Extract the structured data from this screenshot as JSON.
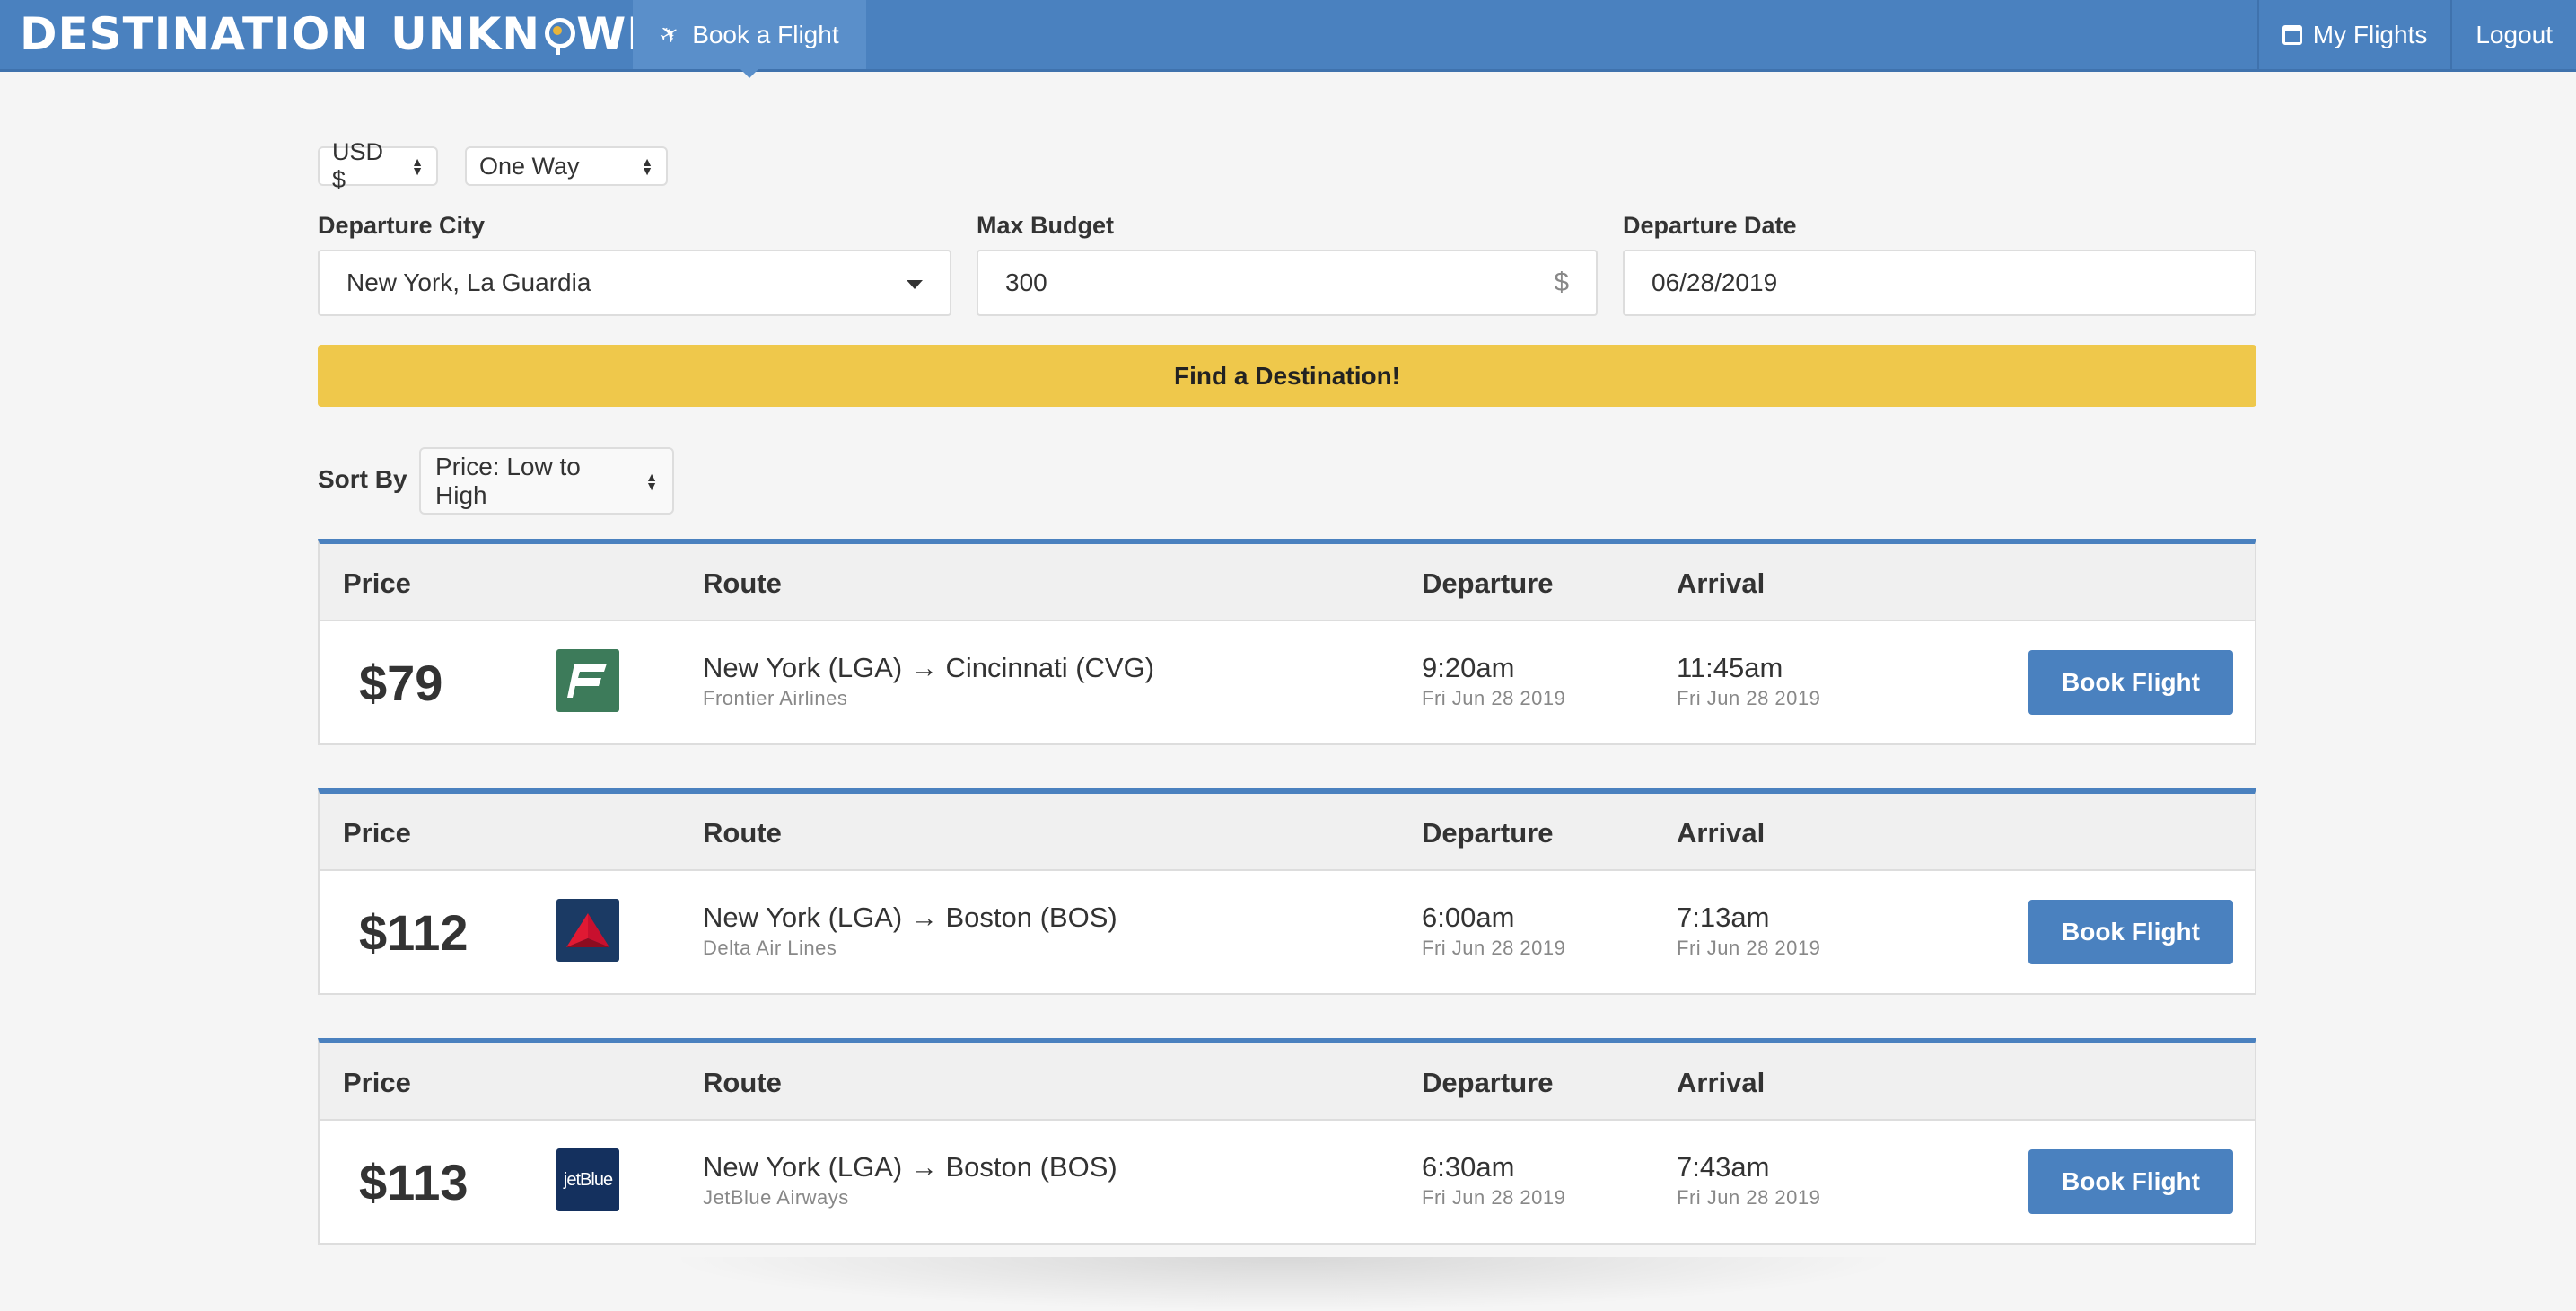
{
  "header": {
    "logo_word1": "DESTINATION",
    "logo_word2_pre": "UNKN",
    "logo_word2_post": "WN",
    "nav_tab": "Book a Flight",
    "nav_right": [
      "My Flights",
      "Logout"
    ],
    "colors": {
      "bar": "#4a81bf",
      "accent_dot": "#e8b43a"
    }
  },
  "form": {
    "currency": "USD $",
    "trip_type": "One Way",
    "departure_city_label": "Departure City",
    "departure_city_value": "New York, La Guardia",
    "max_budget_label": "Max Budget",
    "max_budget_value": "300",
    "budget_unit": "$",
    "departure_date_label": "Departure Date",
    "departure_date_value": "06/28/2019",
    "find_button": "Find a Destination!",
    "find_button_color": "#efc84b",
    "sort_label": "Sort By",
    "sort_value": "Price: Low to High"
  },
  "columns": {
    "price": "Price",
    "route": "Route",
    "departure": "Departure",
    "arrival": "Arrival"
  },
  "results": [
    {
      "price": "$79",
      "logo": "frontier-logo",
      "logo_color": "#3d7b5a",
      "route": "New York (LGA) → Cincinnati (CVG)",
      "airline": "Frontier Airlines",
      "dep_time": "9:20am",
      "dep_date": "Fri Jun 28 2019",
      "arr_time": "11:45am",
      "arr_date": "Fri Jun 28 2019",
      "button": "Book Flight"
    },
    {
      "price": "$112",
      "logo": "delta-logo",
      "logo_color": "#1b3a64",
      "route": "New York (LGA) → Boston (BOS)",
      "airline": "Delta Air Lines",
      "dep_time": "6:00am",
      "dep_date": "Fri Jun 28 2019",
      "arr_time": "7:13am",
      "arr_date": "Fri Jun 28 2019",
      "button": "Book Flight"
    },
    {
      "price": "$113",
      "logo": "jetblue-logo",
      "logo_color": "#14305e",
      "logo_text": "jetBlue",
      "route": "New York (LGA) → Boston (BOS)",
      "airline": "JetBlue Airways",
      "dep_time": "6:30am",
      "dep_date": "Fri Jun 28 2019",
      "arr_time": "7:43am",
      "arr_date": "Fri Jun 28 2019",
      "button": "Book Flight"
    }
  ]
}
